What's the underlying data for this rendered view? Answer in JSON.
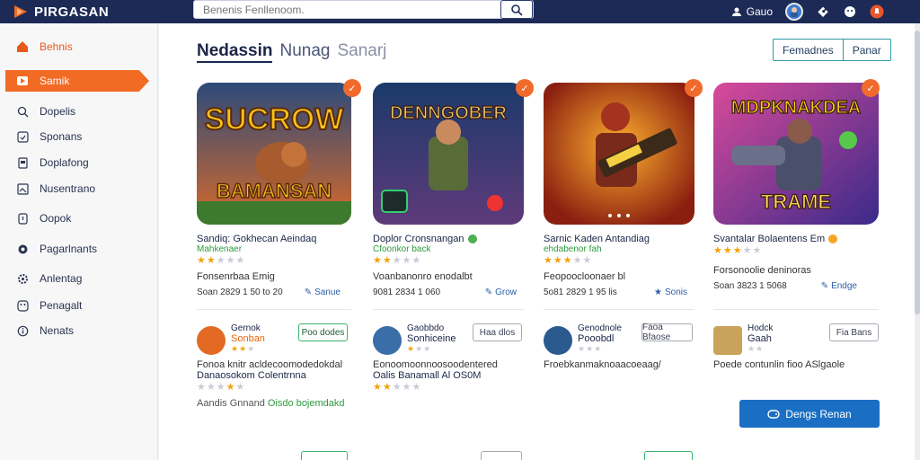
{
  "app": {
    "name": "PIRGASAN",
    "brand_color": "#f26b25",
    "nav_color": "#1c2a55"
  },
  "search": {
    "placeholder": "Benenis Fenllenoom.",
    "icon": "search-icon"
  },
  "topbar": {
    "user_label": "Gauo",
    "icons": [
      "user-icon",
      "avatar",
      "puzzle-icon",
      "emoji-icon",
      "notification-icon"
    ]
  },
  "sidebar": {
    "items": [
      {
        "label": "Behnis",
        "icon": "home-icon"
      },
      {
        "label": "Samik",
        "icon": "play-icon"
      },
      {
        "label": "Dopelis",
        "icon": "search-icon"
      },
      {
        "label": "Sponans",
        "icon": "refresh-icon"
      },
      {
        "label": "Doplafong",
        "icon": "document-icon"
      },
      {
        "label": "Nusentrano",
        "icon": "image-icon"
      },
      {
        "label": "Oopok",
        "icon": "bookmark-icon"
      },
      {
        "label": "Pagarlnants",
        "icon": "circle-icon"
      },
      {
        "label": "Anlentag",
        "icon": "gear-icon"
      },
      {
        "label": "Penagalt",
        "icon": "box-icon"
      },
      {
        "label": "Nenats",
        "icon": "info-icon"
      }
    ]
  },
  "main": {
    "heading": {
      "primary": "Nedassin",
      "secondary": "Nunag",
      "tertiary": "Sanarj"
    },
    "segment": [
      "Femadnes",
      "Panar"
    ],
    "games": [
      {
        "art_title": "SUCROW",
        "art_sub": "BAMANSAN",
        "title": "Sandiq: Gokhecan Aeindaq",
        "sub": "Mahkenaer",
        "rating": 2,
        "desc": "Fonsenrbaa Emig",
        "meta": "Soan 2829 1 50 to 20",
        "action": "Sanue",
        "badge": "✓"
      },
      {
        "art_title": "DENNGOBER",
        "art_sub": "",
        "title": "Doplor Cronsnangan",
        "sub": "Cfoonkor back",
        "rating": 2,
        "desc": "Voanbanonro enodalbt",
        "meta": "9081 2834 1 060",
        "action": "Grow",
        "badge": "✓"
      },
      {
        "art_title": "",
        "art_sub": "",
        "title": "Sarnic Kaden Antandiag",
        "sub": "ehdabenor fah",
        "rating": 3,
        "desc": "Feopoocloonaer bl",
        "meta": "5o81 2829 1 95 lis",
        "action": "Sonis",
        "badge": "✓"
      },
      {
        "art_title": "MDPKNAKDEA",
        "art_sub": "TRAME",
        "title": "Svantalar Bolaentens Em",
        "sub": "",
        "rating": 3,
        "desc": "Forsonoolie deninoras",
        "meta": "Soan 3823 1 5068",
        "action": "Endge",
        "badge": "✓"
      }
    ],
    "list": [
      {
        "name": "Gernok",
        "sub": "Sonban",
        "btn": "Poo dodes",
        "desc": "Fonoa knitr acldecoomodedokdal",
        "desc2": "Danaosokom Colentrnna",
        "rating": 3,
        "foot": "Aandis Gnnand",
        "foot2": "Oisdo bojemdakd"
      },
      {
        "name": "Gaobbdo",
        "sub": "Sonhiceine",
        "btn": "Haa dlos",
        "desc": "Eonoomoonnoosoodentered",
        "desc2": "Oalis Banamall Al OS0M",
        "rating": 2,
        "foot": "",
        "foot2": ""
      },
      {
        "name": "Genodnole",
        "sub": "Pooobdl",
        "btn": "Faoa Bfaose",
        "desc": "Froebkanmaknoaacoeaag/",
        "desc2": "",
        "rating": 0,
        "foot": "",
        "foot2": ""
      },
      {
        "name": "Hodck",
        "sub": "Gaah",
        "btn": "Fia Bans",
        "desc": "Poede contunlin fioo ASlgaole",
        "desc2": "",
        "rating": 0,
        "foot": "",
        "foot2": ""
      }
    ],
    "primary_button": "Dengs Renan"
  }
}
